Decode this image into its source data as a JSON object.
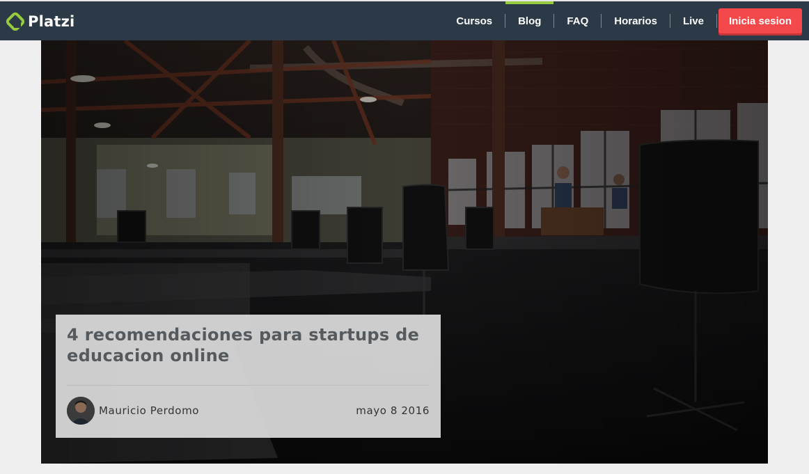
{
  "brand": {
    "name": "Platzi",
    "icon": "platzi-logo-icon",
    "color": "#98ca3f"
  },
  "nav": {
    "items": [
      {
        "label": "Cursos",
        "active": false
      },
      {
        "label": "Blog",
        "active": true
      },
      {
        "label": "FAQ",
        "active": false
      },
      {
        "label": "Horarios",
        "active": false
      },
      {
        "label": "Live",
        "active": false
      }
    ],
    "login_label": "Inicia sesion"
  },
  "post": {
    "title": "4 recomendaciones para startups de educacion online",
    "author": "Mauricio Perdomo",
    "date": "mayo 8 2016",
    "hero_image": "dark office interior with desks, chairs and two people near windows"
  },
  "colors": {
    "topbar": "#2b3a46",
    "accent": "#98ca3f",
    "login": "#f5484a"
  }
}
